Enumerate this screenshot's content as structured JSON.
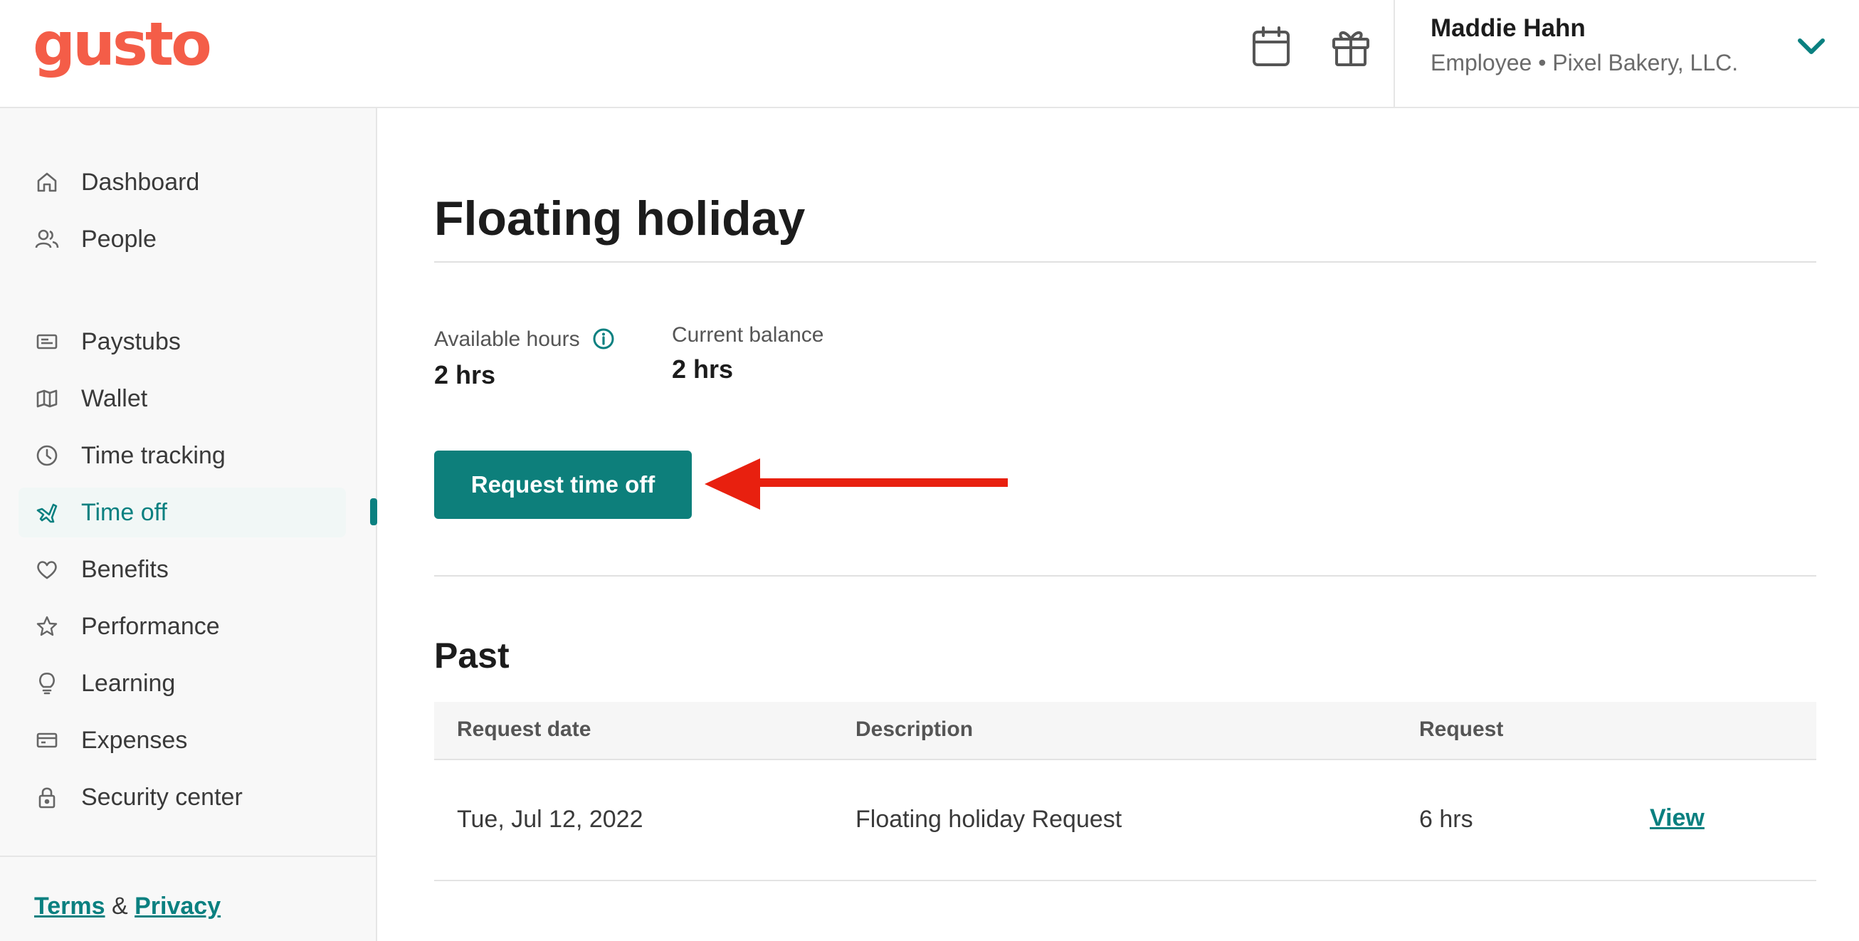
{
  "brand": {
    "logo_text": "gusto",
    "logo_color": "#f45d48",
    "accent": "#0d7f7b"
  },
  "header": {
    "icons": [
      "calendar-icon",
      "gift-icon",
      "chevron-down-icon"
    ],
    "user": {
      "name": "Maddie Hahn",
      "role": "Employee • Pixel Bakery, LLC."
    }
  },
  "sidebar": {
    "items": [
      {
        "label": "Dashboard",
        "icon": "home-icon"
      },
      {
        "label": "People",
        "icon": "people-icon"
      },
      {
        "label": "Paystubs",
        "icon": "paystub-icon"
      },
      {
        "label": "Wallet",
        "icon": "wallet-icon"
      },
      {
        "label": "Time tracking",
        "icon": "clock-icon"
      },
      {
        "label": "Time off",
        "icon": "airplane-icon",
        "active": true
      },
      {
        "label": "Benefits",
        "icon": "heart-icon"
      },
      {
        "label": "Performance",
        "icon": "star-icon"
      },
      {
        "label": "Learning",
        "icon": "lightbulb-icon"
      },
      {
        "label": "Expenses",
        "icon": "credit-card-icon"
      },
      {
        "label": "Security center",
        "icon": "lock-icon"
      }
    ],
    "footer": {
      "terms": "Terms",
      "amp": "&",
      "privacy": "Privacy"
    }
  },
  "main": {
    "title": "Floating holiday",
    "stats": {
      "available_label": "Available hours",
      "available_value": "2 hrs",
      "balance_label": "Current balance",
      "balance_value": "2 hrs"
    },
    "request_button": "Request time off",
    "past": {
      "title": "Past",
      "columns": [
        "Request date",
        "Description",
        "Request"
      ],
      "rows": [
        {
          "date": "Tue, Jul 12, 2022",
          "description": "Floating holiday Request",
          "request": "6 hrs",
          "action": "View"
        }
      ]
    }
  }
}
